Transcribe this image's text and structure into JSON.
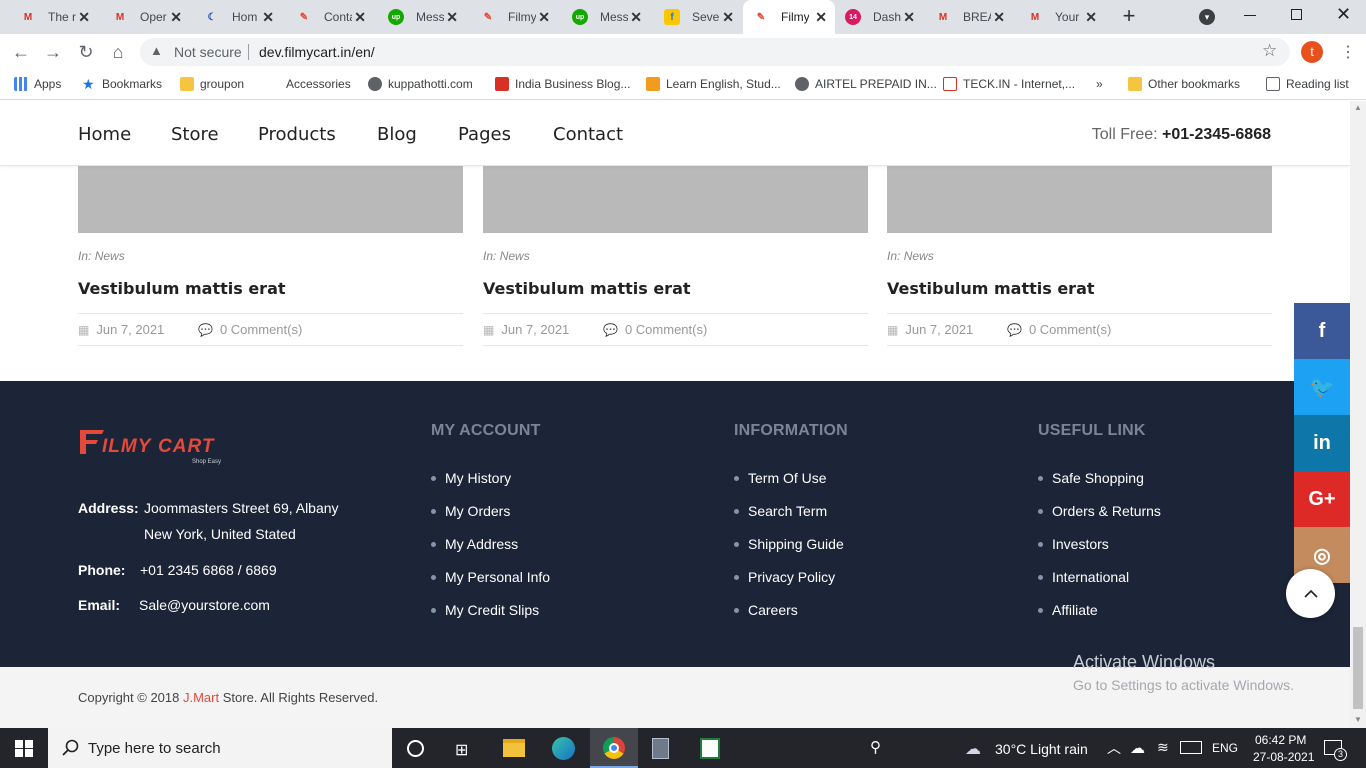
{
  "browser": {
    "tabs": [
      {
        "label": "The r",
        "icon": "gmail-icon",
        "color": "#d93025"
      },
      {
        "label": "Oper",
        "icon": "gmail-icon",
        "color": "#d93025"
      },
      {
        "label": "Hom",
        "icon": "moon-icon",
        "color": "#2a52be"
      },
      {
        "label": "Conta",
        "icon": "filmycart-icon",
        "color": "#e5493a"
      },
      {
        "label": "Mess",
        "icon": "upwork-icon",
        "color": "#14a800"
      },
      {
        "label": "Filmy",
        "icon": "filmycart-icon",
        "color": "#e5493a"
      },
      {
        "label": "Mess",
        "icon": "upwork-icon",
        "color": "#14a800"
      },
      {
        "label": "Sever",
        "icon": "flipkart-icon",
        "color": "#f9c700"
      },
      {
        "label": "Filmy",
        "icon": "filmycart-icon",
        "color": "#e5493a",
        "active": true
      },
      {
        "label": "Dash",
        "icon": "dashboard-icon",
        "color": "#d81b60"
      },
      {
        "label": "BREA",
        "icon": "gmail-icon",
        "color": "#d93025"
      },
      {
        "label": "Your",
        "icon": "gmail-icon",
        "color": "#d93025"
      }
    ],
    "security_label": "Not secure",
    "url": "dev.filmycart.in/en/",
    "profile_initial": "t",
    "bookmarks": [
      {
        "label": "Apps",
        "icon": "apps-grid-icon"
      },
      {
        "label": "Bookmarks",
        "icon": "star-icon"
      },
      {
        "label": "groupon",
        "icon": "folder-icon"
      },
      {
        "label": "Accessories",
        "icon": "max-icon"
      },
      {
        "label": "kuppathotti.com",
        "icon": "globe-icon"
      },
      {
        "label": "India Business Blog...",
        "icon": "blog-icon"
      },
      {
        "label": "Learn English, Stud...",
        "icon": "play-icon"
      },
      {
        "label": "AIRTEL PREPAID IN...",
        "icon": "globe-icon"
      },
      {
        "label": "TECK.IN - Internet,...",
        "icon": "teck-icon"
      },
      {
        "label": "»",
        "icon": ""
      },
      {
        "label": "Other bookmarks",
        "icon": "folder-icon"
      },
      {
        "label": "Reading list",
        "icon": "reading-list-icon"
      }
    ]
  },
  "site": {
    "menu": [
      "Home",
      "Store",
      "Products",
      "Blog",
      "Pages",
      "Contact"
    ],
    "toll_free_label": "Toll Free:",
    "toll_free_number": "+01-2345-6868",
    "cards": [
      {
        "category_prefix": "In:",
        "category": "News",
        "title": "Vestibulum mattis erat",
        "date": "Jun 7, 2021",
        "comments": "0 Comment(s)"
      },
      {
        "category_prefix": "In:",
        "category": "News",
        "title": "Vestibulum mattis erat",
        "date": "Jun 7, 2021",
        "comments": "0 Comment(s)"
      },
      {
        "category_prefix": "In:",
        "category": "News",
        "title": "Vestibulum mattis erat",
        "date": "Jun 7, 2021",
        "comments": "0 Comment(s)"
      }
    ],
    "footer": {
      "logo_text": "FILMYCART",
      "logo_tagline": "Shop Easy",
      "address_label": "Address:",
      "address_line1": "Joommasters Street 69, Albany",
      "address_line2": "New York, United Stated",
      "phone_label": "Phone:",
      "phone": "+01 2345 6868 / 6869",
      "email_label": "Email:",
      "email": "Sale@yourstore.com",
      "columns": [
        {
          "heading": "MY ACCOUNT",
          "links": [
            "My History",
            "My Orders",
            "My Address",
            "My Personal Info",
            "My Credit Slips"
          ]
        },
        {
          "heading": "INFORMATION",
          "links": [
            "Term Of Use",
            "Search Term",
            "Shipping Guide",
            "Privacy Policy",
            "Careers"
          ]
        },
        {
          "heading": "USEFUL LINK",
          "links": [
            "Safe Shopping",
            "Orders & Returns",
            "Investors",
            "International",
            "Affiliate"
          ]
        }
      ],
      "copyright_prefix": "Copyright © 2018 ",
      "copyright_brand": "J.Mart",
      "copyright_suffix": " Store. All Rights Reserved."
    },
    "social": [
      {
        "name": "facebook",
        "glyph": "f",
        "color": "#3b5998"
      },
      {
        "name": "twitter",
        "glyph": "🐦",
        "color": "#1da1f2"
      },
      {
        "name": "linkedin",
        "glyph": "in",
        "color": "#0e76a8"
      },
      {
        "name": "google-plus",
        "glyph": "G+",
        "color": "#dd2a27"
      },
      {
        "name": "instagram",
        "glyph": "◎",
        "color": "#c48c5e"
      }
    ]
  },
  "windows_watermark": {
    "line1": "Activate Windows",
    "line2": "Go to Settings to activate Windows."
  },
  "taskbar": {
    "search_placeholder": "Type here to search",
    "weather": "30°C  Light rain",
    "language": "ENG",
    "time": "06:42 PM",
    "date": "27-08-2021",
    "notification_count": "3"
  }
}
